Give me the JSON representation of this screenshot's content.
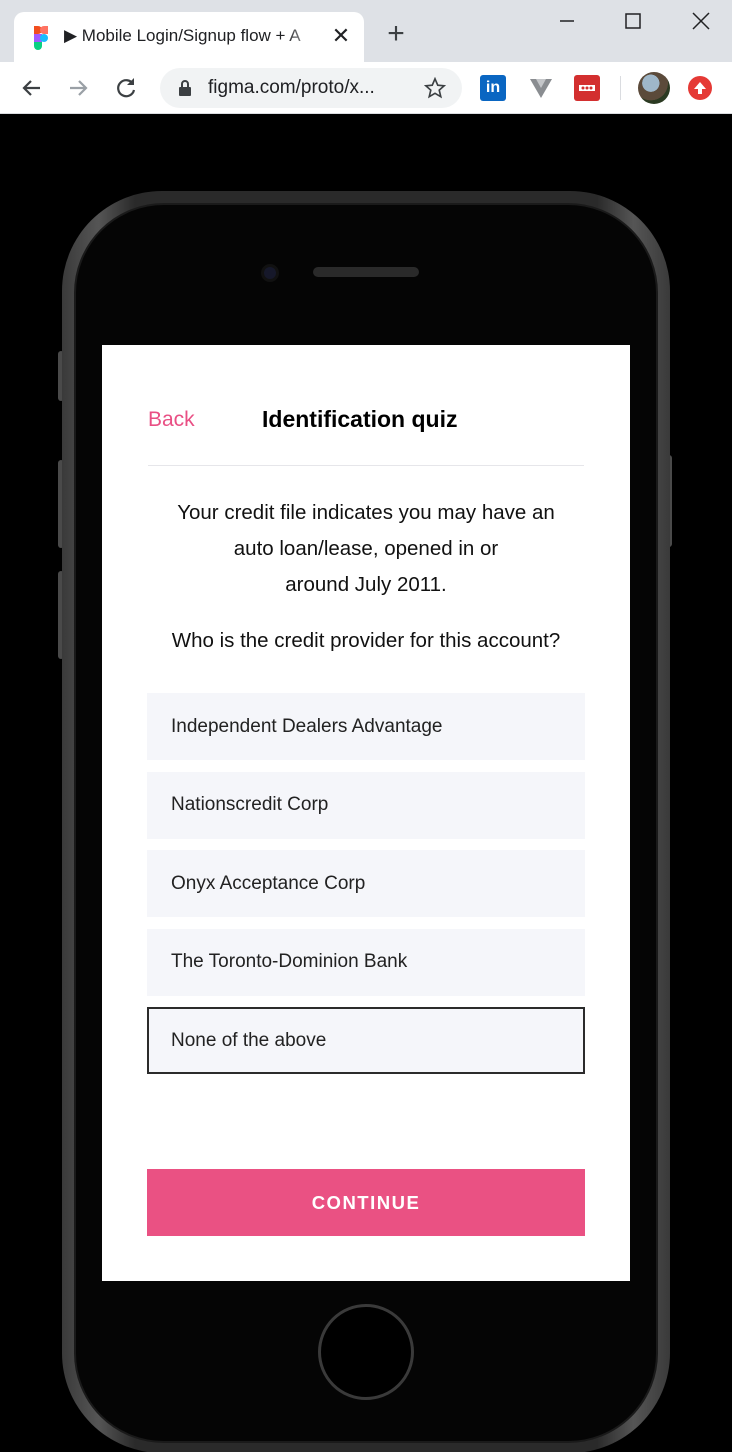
{
  "browser": {
    "tab_title": "▶ Mobile Login/Signup flow + A",
    "url": "figma.com/proto/x...",
    "close_glyph": "✕",
    "new_tab_glyph": "+",
    "extensions": {
      "linkedin_label": "in"
    }
  },
  "screen": {
    "back_label": "Back",
    "title": "Identification quiz",
    "question_lines": [
      "Your credit file indicates you may have an",
      "auto loan/lease, opened in or",
      "around July 2011."
    ],
    "prompt": "Who is the credit provider for this account?",
    "options": [
      {
        "label": "Independent Dealers Advantage",
        "selected": false
      },
      {
        "label": "Nationscredit Corp",
        "selected": false
      },
      {
        "label": "Onyx Acceptance Corp",
        "selected": false
      },
      {
        "label": "The Toronto-Dominion Bank",
        "selected": false
      },
      {
        "label": "None of the above",
        "selected": true
      }
    ],
    "continue_label": "CONTINUE"
  },
  "colors": {
    "accent": "#ea5183",
    "back_link": "#e94f84",
    "option_bg": "#f5f6fa",
    "selected_border": "#2b2b2b"
  },
  "icons": [
    "figma-favicon-icon",
    "close-icon",
    "plus-icon",
    "minimize-icon",
    "maximize-icon",
    "window-close-icon",
    "back-arrow-icon",
    "forward-arrow-icon",
    "reload-icon",
    "lock-icon",
    "star-icon",
    "linkedin-icon",
    "vue-devtools-icon",
    "red-extension-icon",
    "profile-avatar-icon",
    "upload-extension-icon"
  ]
}
